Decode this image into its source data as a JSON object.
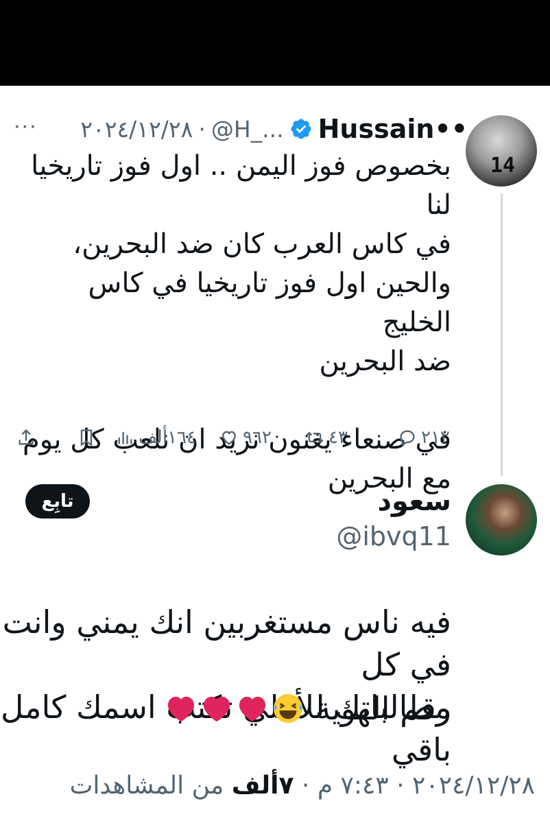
{
  "parent_tweet": {
    "name": "Hussain••",
    "handle": "@H_...",
    "separator": "·",
    "date": "٢٠٢٤/١٢/٢٨",
    "more": "···",
    "text": "بخصوص فوز اليمن .. اول فوز تاريخيا لنا\nفي كاس العرب كان ضد البحرين،\nوالحين اول فوز تاريخيا في كاس الخليج\nضد البحرين\n\nفي صنعاء يغنون نريد ان نلعب كل يوم\nمع البحرين",
    "avatar_jersey": "14",
    "actions": {
      "replies": "٢١٢",
      "reposts": "٤٣",
      "likes": "٩٦٢",
      "views": "١٦٤ألف"
    },
    "icons": [
      "reply-icon",
      "repost-icon",
      "like-icon",
      "views-icon",
      "bookmark-icon",
      "share-icon",
      "verified-icon"
    ]
  },
  "reply_tweet": {
    "name": "سعود",
    "handle": "@ibvq11",
    "follow_label": "تابِع",
    "text": "فيه ناس مستغربين انك يمني وانت في كل\nمطالباتك للأهلي تكتب اسمك كامل باقي",
    "last_line": "رقم الهوية",
    "emojis": [
      "laugh-icon",
      "heart-icon",
      "heart-icon",
      "heart-icon"
    ],
    "footer": {
      "date": "٢٠٢٤/١٢/٢٨",
      "dot": "·",
      "time": "٧:٤٣ م",
      "views_count": "٧ألف",
      "views_label": "من المشاهدات"
    }
  },
  "colors": {
    "text": "#0f1419",
    "secondary": "#536471",
    "verified": "#1d9bf0",
    "heart": "#e0245e",
    "divider": "#cfd9de"
  }
}
